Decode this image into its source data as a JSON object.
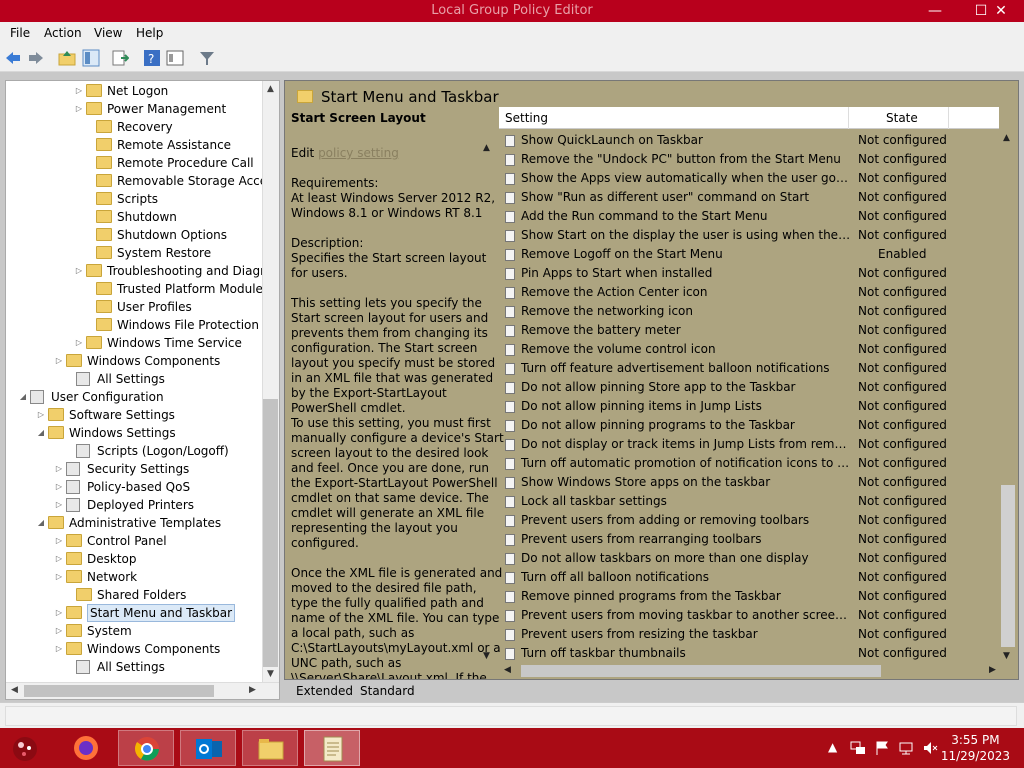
{
  "window": {
    "title": "Local Group Policy Editor",
    "minimize_glyph": "—",
    "maximize_glyph": "☐",
    "close_glyph": "✕"
  },
  "menu": [
    "File",
    "Action",
    "View",
    "Help"
  ],
  "toolbar_icons": [
    "back-arrow-icon",
    "forward-arrow-icon",
    "up-folder-icon",
    "show-hide-tree-icon",
    "export-list-icon",
    "help-icon",
    "properties-icon",
    "filter-icon"
  ],
  "tree": [
    {
      "label": "Net Logon",
      "expander": true,
      "icon": "folder"
    },
    {
      "label": "Power Management",
      "expander": true,
      "icon": "folder"
    },
    {
      "label": "Recovery",
      "expander": false,
      "icon": "folder"
    },
    {
      "label": "Remote Assistance",
      "expander": false,
      "icon": "folder"
    },
    {
      "label": "Remote Procedure Call",
      "expander": false,
      "icon": "folder"
    },
    {
      "label": "Removable Storage Access",
      "expander": false,
      "icon": "folder"
    },
    {
      "label": "Scripts",
      "expander": false,
      "icon": "folder"
    },
    {
      "label": "Shutdown",
      "expander": false,
      "icon": "folder"
    },
    {
      "label": "Shutdown Options",
      "expander": false,
      "icon": "folder"
    },
    {
      "label": "System Restore",
      "expander": false,
      "icon": "folder"
    },
    {
      "label": "Troubleshooting and Diagnos",
      "expander": true,
      "icon": "folder"
    },
    {
      "label": "Trusted Platform Module Serv",
      "expander": false,
      "icon": "folder"
    },
    {
      "label": "User Profiles",
      "expander": false,
      "icon": "folder"
    },
    {
      "label": "Windows File Protection",
      "expander": false,
      "icon": "folder"
    },
    {
      "label": "Windows Time Service",
      "expander": true,
      "icon": "folder"
    },
    {
      "label": "Windows Components",
      "expander": true,
      "icon": "folder"
    },
    {
      "label": "All Settings",
      "expander": false,
      "icon": "settings"
    },
    {
      "label": "User Configuration",
      "expander": "open",
      "icon": "user"
    },
    {
      "label": "Software Settings",
      "expander": true,
      "icon": "folder"
    },
    {
      "label": "Windows Settings",
      "expander": "open",
      "icon": "folder"
    },
    {
      "label": "Scripts (Logon/Logoff)",
      "expander": false,
      "icon": "script"
    },
    {
      "label": "Security Settings",
      "expander": true,
      "icon": "security"
    },
    {
      "label": "Policy-based QoS",
      "expander": true,
      "icon": "chart"
    },
    {
      "label": "Deployed Printers",
      "expander": true,
      "icon": "printer"
    },
    {
      "label": "Administrative Templates",
      "expander": "open",
      "icon": "folder"
    },
    {
      "label": "Control Panel",
      "expander": true,
      "icon": "folder"
    },
    {
      "label": "Desktop",
      "expander": true,
      "icon": "folder"
    },
    {
      "label": "Network",
      "expander": true,
      "icon": "folder"
    },
    {
      "label": "Shared Folders",
      "expander": false,
      "icon": "folder"
    },
    {
      "label": "Start Menu and Taskbar",
      "expander": true,
      "icon": "folder",
      "selected": true
    },
    {
      "label": "System",
      "expander": true,
      "icon": "folder"
    },
    {
      "label": "Windows Components",
      "expander": true,
      "icon": "folder"
    },
    {
      "label": "All Settings",
      "expander": false,
      "icon": "settings"
    }
  ],
  "content": {
    "header": "Start Menu and Taskbar",
    "desc_title": "Start Screen Layout",
    "edit_prefix": "Edit ",
    "edit_link": "policy setting ",
    "requirements": "Requirements:\nAt least Windows Server 2012 R2, Windows 8.1 or Windows RT 8.1",
    "description": "Description:\nSpecifies the Start screen layout for users.",
    "body1": "This setting lets you specify the Start screen layout for users and prevents them from changing its configuration. The Start screen layout you specify must be stored in an XML file that was generated by the Export-StartLayout PowerShell cmdlet.\nTo use this setting, you must first manually configure a device's Start screen layout to the desired look and feel. Once you are  done, run the Export-StartLayout PowerShell cmdlet on that same device. The cmdlet will generate an XML file representing the layout you configured.",
    "body2": "Once the XML file is generated and moved to the desired file path, type the fully qualified path and name of the XML file. You can type a local path, such as C:\\StartLayouts\\myLayout.xml or a UNC path, such as \\\\Server\\Share\\Layout.xml. If the"
  },
  "list": {
    "col_setting": "Setting",
    "col_state": "State",
    "rows": [
      {
        "name": "Show QuickLaunch on Taskbar",
        "state": "Not configured"
      },
      {
        "name": "Remove the \"Undock PC\" button from the Start Menu",
        "state": "Not configured"
      },
      {
        "name": "Show the Apps view automatically when the user goes to St...",
        "state": "Not configured"
      },
      {
        "name": "Show \"Run as different user\" command on Start",
        "state": "Not configured"
      },
      {
        "name": "Add the Run command to the Start Menu",
        "state": "Not configured"
      },
      {
        "name": "Show Start on the display the user is using when they press t...",
        "state": "Not configured"
      },
      {
        "name": "Remove Logoff on the Start Menu",
        "state": "Enabled"
      },
      {
        "name": "Pin Apps to Start when installed",
        "state": "Not configured"
      },
      {
        "name": "Remove the Action Center icon",
        "state": "Not configured"
      },
      {
        "name": "Remove the networking icon",
        "state": "Not configured"
      },
      {
        "name": "Remove the battery meter",
        "state": "Not configured"
      },
      {
        "name": "Remove the volume control icon",
        "state": "Not configured"
      },
      {
        "name": "Turn off feature advertisement balloon notifications",
        "state": "Not configured"
      },
      {
        "name": "Do not allow pinning Store app to the Taskbar",
        "state": "Not configured"
      },
      {
        "name": "Do not allow pinning items in Jump Lists",
        "state": "Not configured"
      },
      {
        "name": "Do not allow pinning programs to the Taskbar",
        "state": "Not configured"
      },
      {
        "name": "Do not display or track items in Jump Lists from remote loca...",
        "state": "Not configured"
      },
      {
        "name": "Turn off automatic promotion of notification icons to the ta...",
        "state": "Not configured"
      },
      {
        "name": "Show Windows Store apps on the taskbar",
        "state": "Not configured"
      },
      {
        "name": "Lock all taskbar settings",
        "state": "Not configured"
      },
      {
        "name": "Prevent users from adding or removing toolbars",
        "state": "Not configured"
      },
      {
        "name": "Prevent users from rearranging toolbars",
        "state": "Not configured"
      },
      {
        "name": "Do not allow taskbars on more than one display",
        "state": "Not configured"
      },
      {
        "name": "Turn off all balloon notifications",
        "state": "Not configured"
      },
      {
        "name": "Remove pinned programs from the Taskbar",
        "state": "Not configured"
      },
      {
        "name": "Prevent users from moving taskbar to another screen dock l...",
        "state": "Not configured"
      },
      {
        "name": "Prevent users from resizing the taskbar",
        "state": "Not configured"
      },
      {
        "name": "Turn off taskbar thumbnails",
        "state": "Not configured"
      }
    ]
  },
  "tabs": {
    "extended": "Extended",
    "standard": "Standard"
  },
  "taskbar": {
    "apps": [
      "start-orb-icon",
      "firefox-icon",
      "chrome-icon",
      "outlook-icon",
      "file-explorer-icon",
      "policy-editor-icon"
    ],
    "time": "3:55 PM",
    "date": "11/29/2023"
  },
  "colors": {
    "titlebar": "#b8001c",
    "taskbar": "#a90b15",
    "content_bg": "#ada480"
  }
}
